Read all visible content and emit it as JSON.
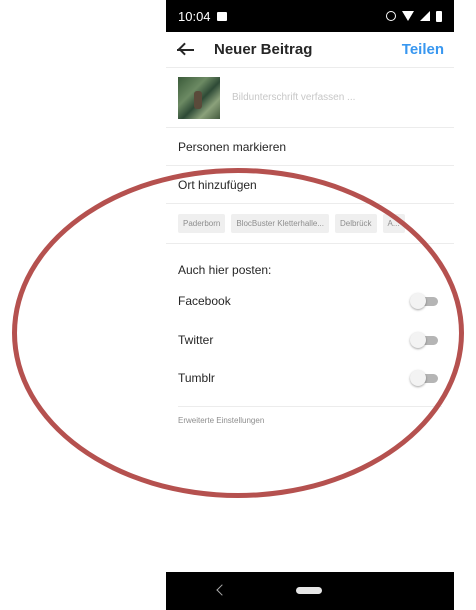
{
  "status_bar": {
    "time": "10:04",
    "icons": [
      "image-notification-icon",
      "alarm-icon",
      "wifi-icon",
      "signal-icon",
      "battery-icon"
    ]
  },
  "header": {
    "title": "Neuer Beitrag",
    "share_label": "Teilen",
    "back_icon": "back-arrow-icon",
    "accent_color": "#3897f0"
  },
  "caption": {
    "placeholder": "Bildunterschrift verfassen ...",
    "value": ""
  },
  "tag_people_label": "Personen markieren",
  "add_location_label": "Ort hinzufügen",
  "location_suggestions": [
    "Paderborn",
    "BlocBuster Kletterhalle...",
    "Delbrück",
    "A..."
  ],
  "also_post_heading": "Auch hier posten:",
  "share_targets": [
    {
      "label": "Facebook",
      "enabled": false
    },
    {
      "label": "Twitter",
      "enabled": false
    },
    {
      "label": "Tumblr",
      "enabled": false
    }
  ],
  "advanced_settings_label": "Erweiterte Einstellungen",
  "annotation_color": "#b5514f"
}
